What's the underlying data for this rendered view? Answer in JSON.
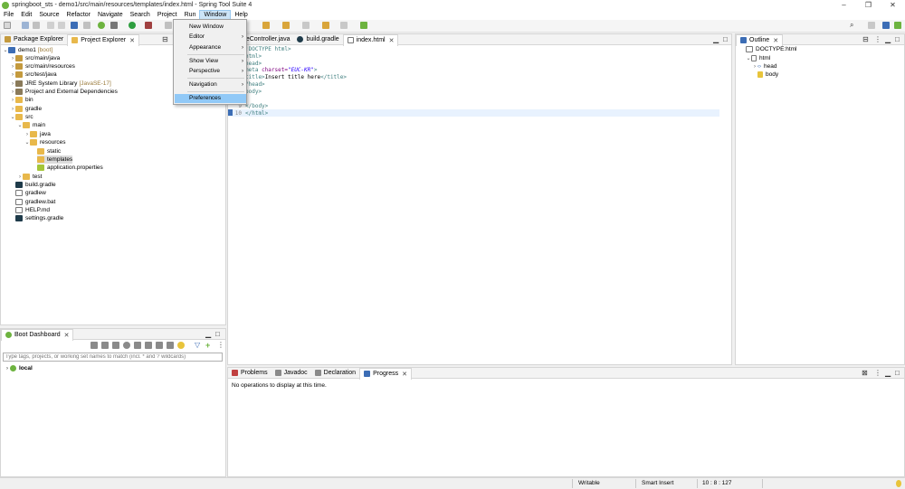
{
  "window": {
    "title": "springboot_sts - demo1/src/main/resources/templates/index.html - Spring Tool Suite 4",
    "minimize": "–",
    "restore": "❐",
    "close": "✕"
  },
  "menubar": [
    "File",
    "Edit",
    "Source",
    "Refactor",
    "Navigate",
    "Search",
    "Project",
    "Run",
    "Window",
    "Help"
  ],
  "window_menu": {
    "items": [
      "New Window",
      "Editor",
      "Appearance",
      "Show View",
      "Perspective",
      "Navigation",
      "Preferences"
    ],
    "submenu_arrow": "›"
  },
  "left_pane": {
    "tabs": [
      "Package Explorer",
      "Project Explorer"
    ],
    "tree": [
      {
        "label": "demo1",
        "decoration": "[boot]"
      },
      {
        "label": "src/main/java",
        "decoration": ""
      },
      {
        "label": "src/main/resources",
        "decoration": ""
      },
      {
        "label": "src/test/java",
        "decoration": ""
      },
      {
        "label": "JRE System Library",
        "decoration": "[JavaSE-17]"
      },
      {
        "label": "Project and External Dependencies",
        "decoration": ""
      },
      {
        "label": "bin",
        "decoration": ""
      },
      {
        "label": "gradle",
        "decoration": ""
      },
      {
        "label": "src",
        "decoration": ""
      },
      {
        "label": "main",
        "decoration": ""
      },
      {
        "label": "java",
        "decoration": ""
      },
      {
        "label": "resources",
        "decoration": ""
      },
      {
        "label": "static",
        "decoration": ""
      },
      {
        "label": "templates",
        "decoration": ""
      },
      {
        "label": "application.properties",
        "decoration": ""
      },
      {
        "label": "test",
        "decoration": ""
      },
      {
        "label": "build.gradle",
        "decoration": ""
      },
      {
        "label": "gradlew",
        "decoration": ""
      },
      {
        "label": "gradlew.bat",
        "decoration": ""
      },
      {
        "label": "HELP.md",
        "decoration": ""
      },
      {
        "label": "settings.gradle",
        "decoration": ""
      }
    ]
  },
  "boot_dashboard": {
    "tab": "Boot Dashboard",
    "filter_placeholder": "Type tags, projects, or working set names to match (incl. * and ? wildcards)",
    "node": "local"
  },
  "editor": {
    "tabs": [
      "meController.java",
      "build.gradle",
      "index.html"
    ],
    "lines": [
      {
        "num": "",
        "a": "!DOCTYPE html>",
        "b": "",
        "c": "",
        "d": ""
      },
      {
        "num": "",
        "a": "html>",
        "b": "",
        "c": "",
        "d": ""
      },
      {
        "num": "",
        "a": "head>",
        "b": "",
        "c": "",
        "d": ""
      },
      {
        "num": "",
        "a": "meta ",
        "b": "charset=",
        "c": "\"EUC-KR\"",
        "d": ">"
      },
      {
        "num": "",
        "a": "title>",
        "b": "Insert title here",
        "c": "</title>",
        "d": ""
      },
      {
        "num": "",
        "a": "/head>",
        "b": "",
        "c": "",
        "d": ""
      },
      {
        "num": "",
        "a": "body>",
        "b": "",
        "c": "",
        "d": ""
      },
      {
        "num": "",
        "a": "",
        "b": "",
        "c": "",
        "d": ""
      },
      {
        "num": "9",
        "a": "</body>",
        "b": "",
        "c": "",
        "d": ""
      },
      {
        "num": "10",
        "a": "</html>",
        "b": "",
        "c": "",
        "d": ""
      }
    ]
  },
  "outline": {
    "tab": "Outline",
    "items": [
      "DOCTYPE:html",
      "html",
      "head",
      "body"
    ]
  },
  "bottom_pane": {
    "tabs": [
      "Problems",
      "Javadoc",
      "Declaration",
      "Progress"
    ],
    "message": "No operations to display at this time."
  },
  "statusbar": {
    "writable": "Writable",
    "insert_mode": "Smart Insert",
    "position": "10 : 8 : 127"
  },
  "colors": {
    "menu_highlight": "#91c9f7",
    "spring_green": "#6db33f",
    "current_line": "#e8f2fe"
  }
}
